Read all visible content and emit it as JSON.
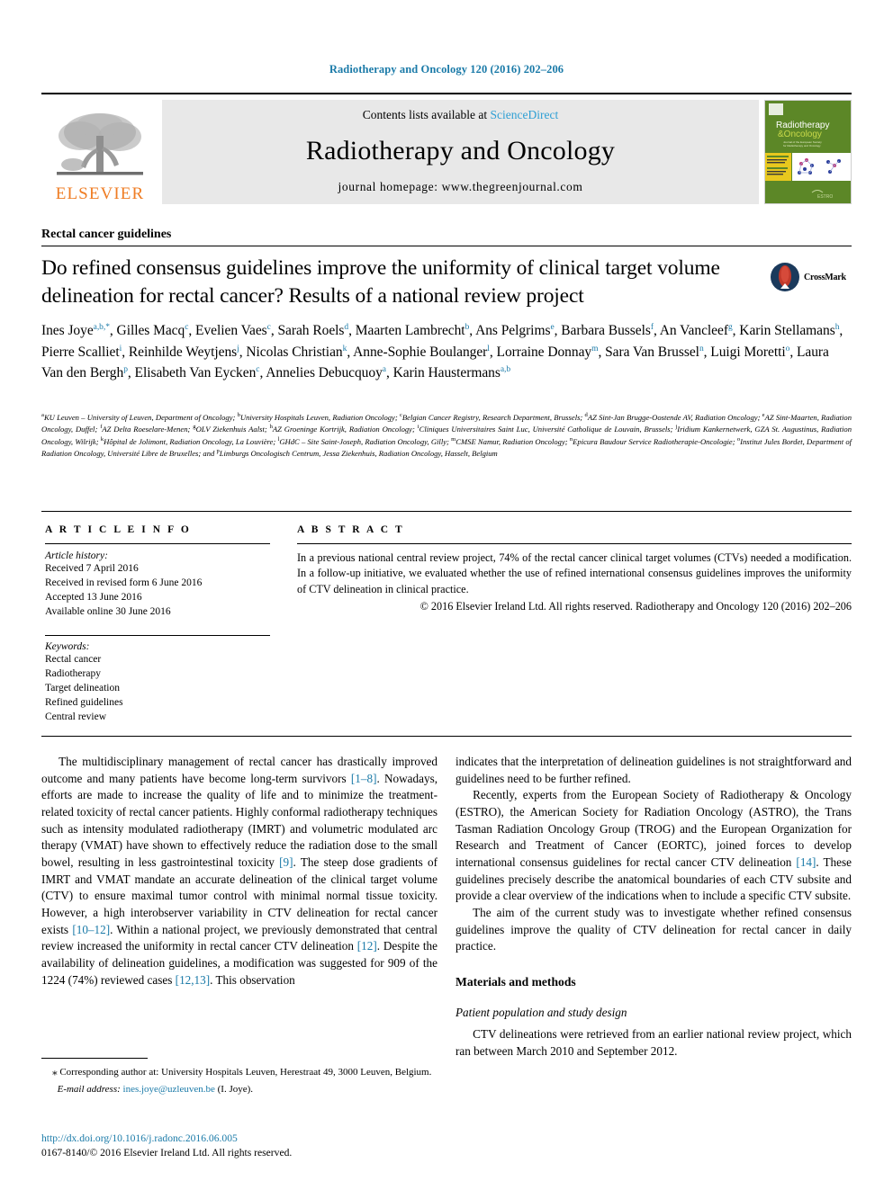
{
  "running_head": "Radiotherapy and Oncology 120 (2016) 202–206",
  "masthead": {
    "publisher_name": "ELSEVIER",
    "contents_prefix": "Contents lists available at ",
    "contents_link": "ScienceDirect",
    "journal_title": "Radiotherapy and Oncology",
    "homepage_line": "journal homepage: www.thegreenjournal.com",
    "cover": {
      "title_line1": "Radiotherapy",
      "title_line2": "&Oncology",
      "subtitle": "Journal of the European Society for Radiotherapy and Oncology",
      "band_color": "#5c8727",
      "accent_color": "#e8c81e"
    }
  },
  "section_label": "Rectal cancer guidelines",
  "title": "Do refined consensus guidelines improve the uniformity of clinical target volume delineation for rectal cancer? Results of a national review project",
  "crossmark": {
    "label": "CrossMark"
  },
  "authors": [
    {
      "name": "Ines Joye",
      "marks": "a,b,*"
    },
    {
      "name": "Gilles Macq",
      "marks": "c"
    },
    {
      "name": "Evelien Vaes",
      "marks": "c"
    },
    {
      "name": "Sarah Roels",
      "marks": "d"
    },
    {
      "name": "Maarten Lambrecht",
      "marks": "b"
    },
    {
      "name": "Ans Pelgrims",
      "marks": "e"
    },
    {
      "name": "Barbara Bussels",
      "marks": "f"
    },
    {
      "name": "An Vancleef",
      "marks": "g"
    },
    {
      "name": "Karin Stellamans",
      "marks": "h"
    },
    {
      "name": "Pierre Scalliet",
      "marks": "i"
    },
    {
      "name": "Reinhilde Weytjens",
      "marks": "j"
    },
    {
      "name": "Nicolas Christian",
      "marks": "k"
    },
    {
      "name": "Anne-Sophie Boulanger",
      "marks": "l"
    },
    {
      "name": "Lorraine Donnay",
      "marks": "m"
    },
    {
      "name": "Sara Van Brussel",
      "marks": "n"
    },
    {
      "name": "Luigi Moretti",
      "marks": "o"
    },
    {
      "name": "Laura Van den Bergh",
      "marks": "p"
    },
    {
      "name": "Elisabeth Van Eycken",
      "marks": "c"
    },
    {
      "name": "Annelies Debucquoy",
      "marks": "a"
    },
    {
      "name": "Karin Haustermans",
      "marks": "a,b"
    }
  ],
  "affiliations": [
    {
      "mark": "a",
      "text": "KU Leuven – University of Leuven, Department of Oncology; "
    },
    {
      "mark": "b",
      "text": "University Hospitals Leuven, Radiation Oncology; "
    },
    {
      "mark": "c",
      "text": "Belgian Cancer Registry, Research Department, Brussels; "
    },
    {
      "mark": "d",
      "text": "AZ Sint-Jan Brugge-Oostende AV, Radiation Oncology; "
    },
    {
      "mark": "e",
      "text": "AZ Sint-Maarten, Radiation Oncology, Duffel; "
    },
    {
      "mark": "f",
      "text": "AZ Delta Roeselare-Menen; "
    },
    {
      "mark": "g",
      "text": "OLV Ziekenhuis Aalst; "
    },
    {
      "mark": "h",
      "text": "AZ Groeninge Kortrijk, Radiation Oncology; "
    },
    {
      "mark": "i",
      "text": "Cliniques Universitaires Saint Luc, Université Catholique de Louvain, Brussels; "
    },
    {
      "mark": "j",
      "text": "Iridium Kankernetwerk, GZA St. Augustinus, Radiation Oncology, Wilrijk; "
    },
    {
      "mark": "k",
      "text": "Hôpital de Jolimont, Radiation Oncology, La Louvière; "
    },
    {
      "mark": "l",
      "text": "GHdC – Site Saint-Joseph, Radiation Oncology, Gilly; "
    },
    {
      "mark": "m",
      "text": "CMSE Namur, Radiation Oncology; "
    },
    {
      "mark": "n",
      "text": "Epicura Baudour Service Radiotherapie-Oncologie; "
    },
    {
      "mark": "o",
      "text": "Institut Jules Bordet, Department of Radiation Oncology, Université Libre de Bruxelles; and "
    },
    {
      "mark": "p",
      "text": "Limburgs Oncologisch Centrum, Jessa Ziekenhuis, Radiation Oncology, Hasselt, Belgium"
    }
  ],
  "article_info": {
    "heading": "A R T I C L E    I N F O",
    "history_label": "Article history:",
    "history": [
      "Received 7 April 2016",
      "Received in revised form 6 June 2016",
      "Accepted 13 June 2016",
      "Available online 30 June 2016"
    ],
    "keywords_label": "Keywords:",
    "keywords": [
      "Rectal cancer",
      "Radiotherapy",
      "Target delineation",
      "Refined guidelines",
      "Central review"
    ]
  },
  "abstract": {
    "heading": "A B S T R A C T",
    "body": "In a previous national central review project, 74% of the rectal cancer clinical target volumes (CTVs) needed a modification. In a follow-up initiative, we evaluated whether the use of refined international consensus guidelines improves the uniformity of CTV delineation in clinical practice.",
    "copyright": "© 2016 Elsevier Ireland Ltd. All rights reserved. Radiotherapy and Oncology 120 (2016) 202–206"
  },
  "body": {
    "left": {
      "para1_a": "The multidisciplinary management of rectal cancer has drastically improved outcome and many patients have become long-term survivors ",
      "para1_ref1": "[1–8]",
      "para1_b": ". Nowadays, efforts are made to increase the quality of life and to minimize the treatment-related toxicity of rectal cancer patients. Highly conformal radiotherapy techniques such as intensity modulated radiotherapy (IMRT) and volumetric modulated arc therapy (VMAT) have shown to effectively reduce the radiation dose to the small bowel, resulting in less gastrointestinal toxicity ",
      "para1_ref2": "[9]",
      "para1_c": ". The steep dose gradients of IMRT and VMAT mandate an accurate delineation of the clinical target volume (CTV) to ensure maximal tumor control with minimal normal tissue toxicity. However, a high interobserver variability in CTV delineation for rectal cancer exists ",
      "para1_ref3": "[10–12]",
      "para1_d": ". Within a national project, we previously demonstrated that central review increased the uniformity in rectal cancer CTV delineation ",
      "para1_ref4": "[12]",
      "para1_e": ". Despite the availability of delineation guidelines, a modification was suggested for 909 of the 1224 (74%) reviewed cases ",
      "para1_ref5": "[12,13]",
      "para1_f": ". This observation"
    },
    "right": {
      "para1": "indicates that the interpretation of delineation guidelines is not straightforward and guidelines need to be further refined.",
      "para2_a": "Recently, experts from the European Society of Radiotherapy & Oncology (ESTRO), the American Society for Radiation Oncology (ASTRO), the Trans Tasman Radiation Oncology Group (TROG) and the European Organization for Research and Treatment of Cancer (EORTC), joined forces to develop international consensus guidelines for rectal cancer CTV delineation ",
      "para2_ref": "[14]",
      "para2_b": ". These guidelines precisely describe the anatomical boundaries of each CTV subsite and provide a clear overview of the indications when to include a specific CTV subsite.",
      "para3": "The aim of the current study was to investigate whether refined consensus guidelines improve the quality of CTV delineation for rectal cancer in daily practice.",
      "heading_materials": "Materials and methods",
      "subhead_patient": "Patient population and study design",
      "para4": "CTV delineations were retrieved from an earlier national review project, which ran between March 2010 and September 2012."
    }
  },
  "footnote": {
    "corresponding": "⁎ Corresponding author at: University Hospitals Leuven, Herestraat 49, 3000 Leuven, Belgium.",
    "email_label": "E-mail address:",
    "email": "ines.joye@uzleuven.be",
    "email_suffix": " (I. Joye)."
  },
  "imprint": {
    "doi": "http://dx.doi.org/10.1016/j.radonc.2016.06.005",
    "issn": "0167-8140/© 2016 Elsevier Ireland Ltd. All rights reserved."
  }
}
